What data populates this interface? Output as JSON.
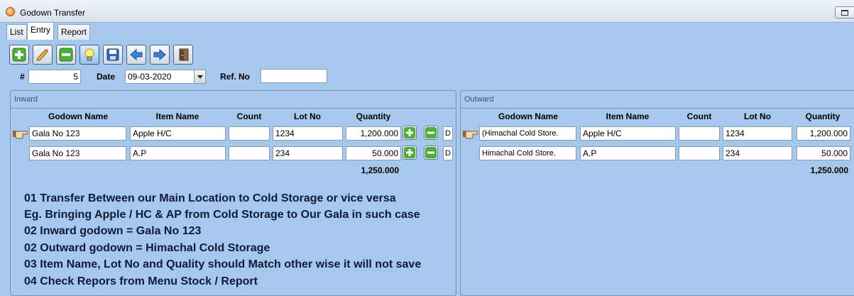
{
  "window": {
    "title": "Godown Transfer"
  },
  "tabs": [
    {
      "label": "List",
      "active": false
    },
    {
      "label": "Entry",
      "active": true
    },
    {
      "label": "Report",
      "active": false
    }
  ],
  "toolbar": {
    "buttons": [
      {
        "name": "add-icon"
      },
      {
        "name": "edit-pencil-icon"
      },
      {
        "name": "delete-icon"
      },
      {
        "name": "lightbulb-icon",
        "pressed": true
      },
      {
        "name": "save-disk-icon"
      },
      {
        "name": "arrow-left-icon"
      },
      {
        "name": "arrow-right-icon"
      },
      {
        "name": "exit-door-icon"
      }
    ]
  },
  "header": {
    "number_label": "#",
    "number_value": "5",
    "date_label": "Date",
    "date_value": "09-03-2020",
    "ref_label": "Ref. No",
    "ref_value": ""
  },
  "inward": {
    "title": "Inward",
    "columns": [
      "Godown Name",
      "Item Name",
      "Count",
      "Lot No",
      "Quantity"
    ],
    "rows": [
      {
        "godown": "Gala No 123",
        "item": "Apple H/C",
        "count": "",
        "lot": "1234",
        "quantity": "1,200.000",
        "flag": "D"
      },
      {
        "godown": "Gala No 123",
        "item": "A.P",
        "count": "",
        "lot": "234",
        "quantity": "50.000",
        "flag": "D"
      }
    ],
    "total": "1,250.000"
  },
  "outward": {
    "title": "Outward",
    "columns": [
      "Godown Name",
      "Item Name",
      "Count",
      "Lot No",
      "Quantity"
    ],
    "rows": [
      {
        "godown": "(Himachal Cold Store.",
        "item": "Apple H/C",
        "count": "",
        "lot": "1234",
        "quantity": "1,200.000"
      },
      {
        "godown": "Himachal Cold Store.",
        "item": "A.P",
        "count": "",
        "lot": "234",
        "quantity": "50.000"
      }
    ],
    "total": "1,250.000"
  },
  "notes": [
    "01 Transfer Between our Main Location to Cold Storage or vice versa",
    "Eg. Bringing Apple / HC & AP from Cold Storage to Our Gala in such case",
    "02 Inward godown = Gala No 123",
    "02 Outward godown = Himachal Cold Storage",
    "03 Item Name, Lot No and Quality should Match other wise it will not save",
    "04 Check Repors from Menu Stock / Report"
  ],
  "colors": {
    "background": "#a6c8ec",
    "note_text": "#101a38",
    "add_green": "#4caf3a"
  }
}
